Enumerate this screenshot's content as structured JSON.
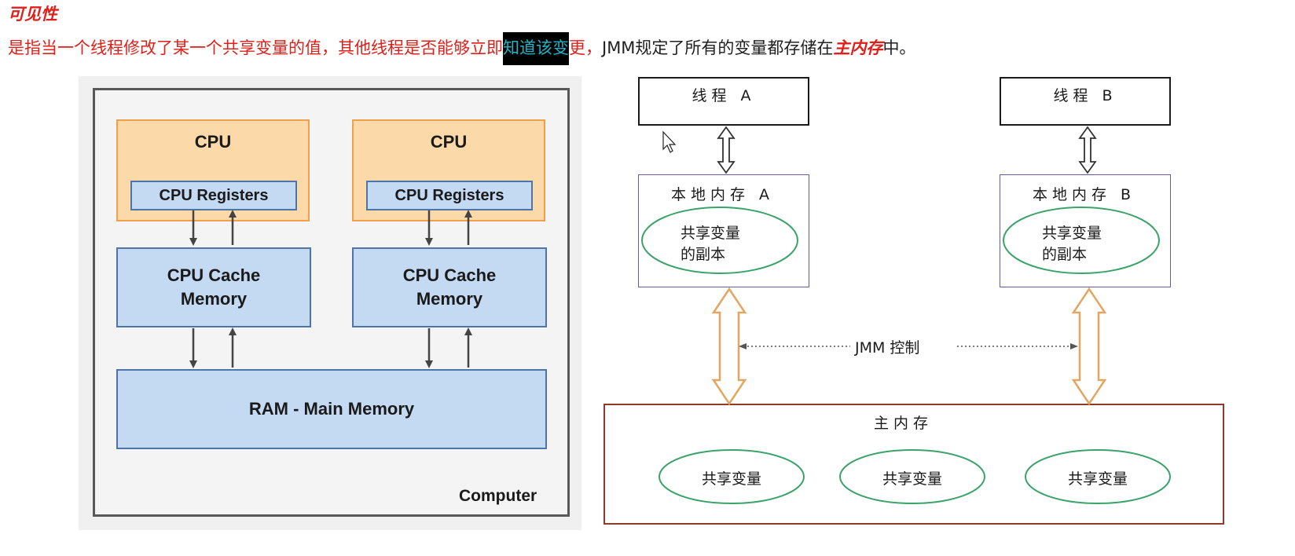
{
  "header": {
    "title": "可见性",
    "desc_red": "是指当一个线程修改了某一个共享变量的值，其他线程是否能够立即",
    "desc_highlight": "知道该变",
    "desc_red_tail": "更，",
    "desc_dark": "JMM规定了所有的变量都存储在",
    "desc_emphasis": "主内存",
    "desc_end": "中。"
  },
  "computer_diagram": {
    "cpu_left": {
      "title": "CPU",
      "registers": "CPU Registers",
      "cache_line1": "CPU Cache",
      "cache_line2": "Memory"
    },
    "cpu_right": {
      "title": "CPU",
      "registers": "CPU Registers",
      "cache_line1": "CPU Cache",
      "cache_line2": "Memory"
    },
    "ram": "RAM - Main Memory",
    "computer_label": "Computer",
    "colors": {
      "cpu_fill": "#fcd9a8",
      "cpu_border": "#f0a04a",
      "mem_fill": "#c4d9f2",
      "mem_border": "#4f74a8"
    }
  },
  "jmm_diagram": {
    "thread_a": "线程 A",
    "thread_b": "线程 B",
    "local_a": "本地内存 A",
    "local_b": "本地内存 B",
    "copy_line1": "共享变量",
    "copy_line2": "的副本",
    "jmm_control": "JMM 控制",
    "main_memory": "主内存",
    "shared_vars": [
      "共享变量",
      "共享变量",
      "共享变量"
    ],
    "colors": {
      "ellipse": "#3aa36a",
      "main_border": "#8e3a2a",
      "arrow_orange": "#e4a560",
      "local_border": "#6a5a9a"
    }
  }
}
